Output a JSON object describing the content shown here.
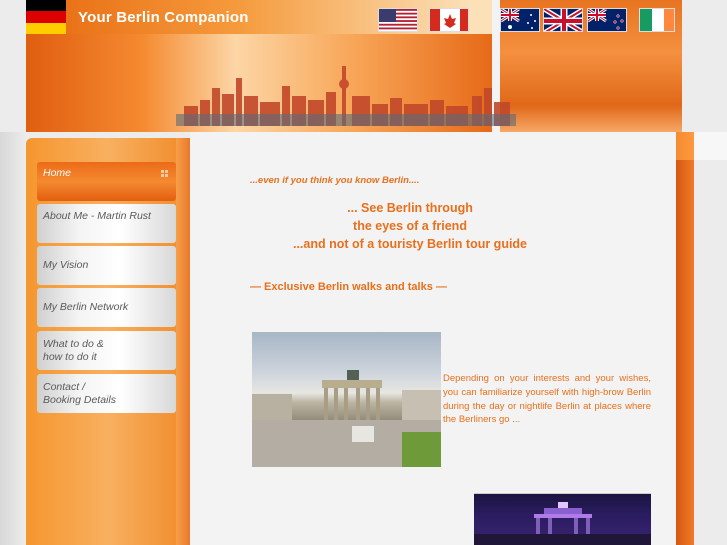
{
  "header": {
    "title": "Your Berlin Companion",
    "flags": [
      {
        "name": "usa-flag"
      },
      {
        "name": "canada-flag"
      },
      {
        "name": "australia-flag"
      },
      {
        "name": "uk-flag"
      },
      {
        "name": "new-zealand-flag"
      },
      {
        "name": "ireland-flag"
      }
    ]
  },
  "nav": {
    "items": [
      {
        "label": "Home",
        "active": true
      },
      {
        "label": "About Me - Martin Rust"
      },
      {
        "label": "My Vision"
      },
      {
        "label": "My Berlin Network"
      },
      {
        "label_line1": "What to do &",
        "label_line2": "how to do it"
      },
      {
        "label_line1": "Contact /",
        "label_line2": "Booking Details"
      }
    ]
  },
  "main": {
    "tagline": "...even if you think you know Berlin....",
    "headline_lines": [
      "... See Berlin through",
      "the eyes of a friend",
      "...and not of a touristy Berlin tour guide"
    ],
    "sub_heading": "— Exclusive Berlin walks and talks —",
    "body_text": "Depending on your interests and your wishes, you can familiarize yourself with high-brow Berlin  during the day or nightlife Berlin at places where the Berliners go ..."
  },
  "colors": {
    "accent": "#e8701c",
    "header_orange": "#f08a2c",
    "nav_active": "#ec6a18",
    "background": "#f3f3f3"
  }
}
